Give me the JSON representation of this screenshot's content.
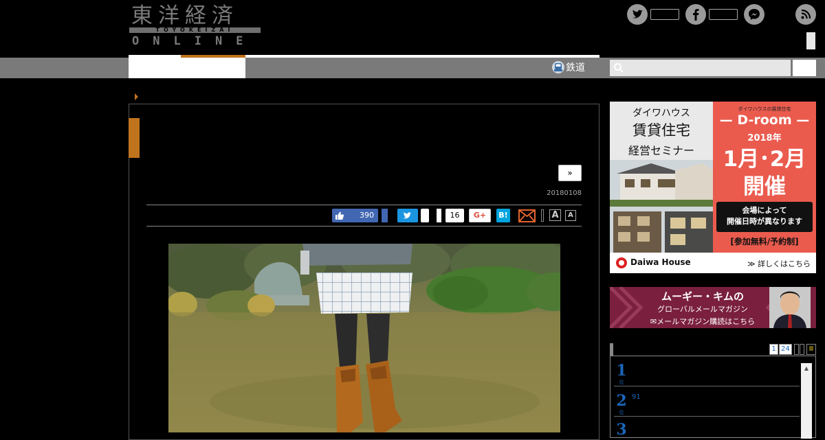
{
  "logo": {
    "kanji": "東洋経済",
    "romaji": "TOYOKEIZAI",
    "online": "ONLINE"
  },
  "header": {
    "social_icons": [
      "twitter-icon",
      "facebook-icon",
      "messenger-icon",
      "rss-icon"
    ]
  },
  "nav": {
    "rail_label": "鉄道"
  },
  "article": {
    "next_label": "»",
    "date": "20180108",
    "share": {
      "like_count": "390",
      "pocket_count": "16",
      "gplus_label": "G+",
      "hatena_label": "B!",
      "font_large": "A",
      "font_small": "A"
    }
  },
  "sidebar": {
    "ad1": {
      "left_line1": "ダイワハウス",
      "left_line2": "賃貸住宅",
      "left_line3": "経営セミナー",
      "right_top": "ダイワハウスの賃貸住宅",
      "right_brand": "D-room",
      "right_year": "2018年",
      "right_dates": "1月･2月",
      "right_event": "開催",
      "right_note1": "会場によって",
      "right_note2": "開催日時が異なります",
      "right_free": "[参加無料/予約制]",
      "bottom_brand": "Daiwa House",
      "bottom_link": "≫ 詳しくはこちら"
    },
    "ad2": {
      "title": "ムーギー・キムの",
      "subtitle": "グローバルメールマガジン",
      "cta": "✉メールマガジン購読はこちら"
    },
    "ranking": {
      "pages": [
        "1",
        "24"
      ],
      "items": [
        {
          "rank": "1",
          "unit": "位",
          "text": ""
        },
        {
          "rank": "2",
          "unit": "位",
          "text": "91"
        },
        {
          "rank": "3",
          "unit": "位",
          "text": ""
        }
      ]
    }
  },
  "colors": {
    "accent": "#c0731d",
    "nav_gray": "#7a7a7a",
    "facebook": "#4267b2",
    "twitter": "#1b95e0",
    "hatena": "#00a4de",
    "rank_blue": "#1a66b8"
  }
}
